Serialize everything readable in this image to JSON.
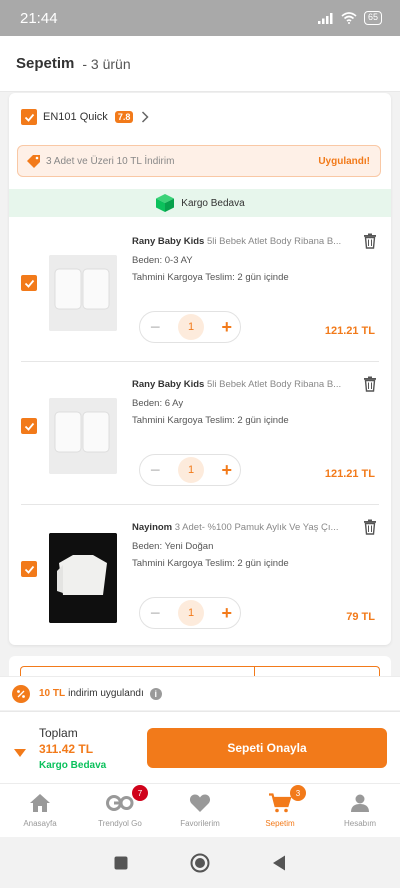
{
  "status_bar": {
    "time": "21:44",
    "battery": "65"
  },
  "header": {
    "title": "Sepetim",
    "count": "- 3 ürün"
  },
  "seller": {
    "name": "EN101 Quick",
    "rating": "7.8"
  },
  "promo": {
    "text": "3 Adet ve Üzeri 10 TL İndirim",
    "status": "Uygulandı!"
  },
  "cargo": {
    "text": "Kargo Bedava"
  },
  "items": [
    {
      "brand": "Rany Baby Kids",
      "name": "5li Bebek Atlet Body Ribana B...",
      "size": "Beden: 0-3 AY",
      "delivery": "Tahmini Kargoya Teslim: 2 gün içinde",
      "quantity": "1",
      "price": "121.21 TL",
      "minus": "−",
      "plus": "+"
    },
    {
      "brand": "Rany Baby Kids",
      "name": "5li Bebek Atlet Body Ribana B...",
      "size": "Beden: 6 Ay",
      "delivery": "Tahmini Kargoya Teslim: 2 gün içinde",
      "quantity": "1",
      "price": "121.21 TL",
      "minus": "−",
      "plus": "+"
    },
    {
      "brand": "Nayinom",
      "name": "3 Adet- %100 Pamuk Aylık Ve Yaş Çı...",
      "size": "Beden: Yeni Doğan",
      "delivery": "Tahmini Kargoya Teslim: 2 gün içinde",
      "quantity": "1",
      "price": "79 TL",
      "minus": "−",
      "plus": "+"
    }
  ],
  "discount": {
    "amount": "10 TL",
    "text": "indirim uygulandı",
    "info": "i"
  },
  "summary": {
    "label": "Toplam",
    "total": "311.42 TL",
    "cargo": "Kargo Bedava",
    "confirm": "Sepeti Onayla"
  },
  "nav": {
    "home": "Anasayfa",
    "go": "Trendyol Go",
    "go_badge": "7",
    "favorites": "Favorilerim",
    "cart": "Sepetim",
    "cart_badge": "3",
    "account": "Hesabım"
  },
  "colors": {
    "accent": "#f27a1a",
    "success": "#0bc15c",
    "badge_red": "#d0021b"
  }
}
